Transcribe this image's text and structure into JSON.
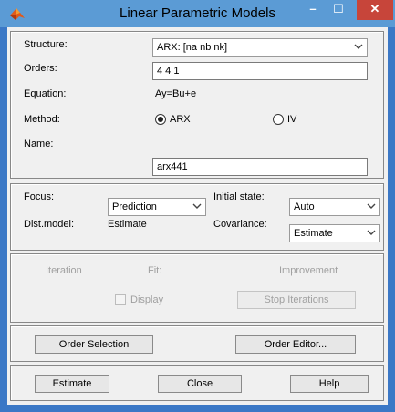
{
  "window": {
    "title": "Linear Parametric Models",
    "controls": {
      "minimize": "–",
      "maximize": "☐",
      "close": "✕"
    }
  },
  "model": {
    "structure_label": "Structure:",
    "structure_value": "ARX: [na nb nk]",
    "orders_label": "Orders:",
    "orders_value": "4 4 1",
    "equation_label": "Equation:",
    "equation_value": "Ay=Bu+e",
    "method_label": "Method:",
    "method_options": [
      "ARX",
      "IV"
    ],
    "method_selected": "ARX",
    "name_label": "Name:",
    "name_value": "arx441"
  },
  "options": {
    "focus_label": "Focus:",
    "focus_value": "Prediction",
    "initial_state_label": "Initial state:",
    "initial_state_value": "Auto",
    "dist_model_label": "Dist.model:",
    "dist_model_value": "Estimate",
    "covariance_label": "Covariance:",
    "covariance_value": "Estimate"
  },
  "progress": {
    "iteration_label": "Iteration",
    "fit_label": "Fit:",
    "improvement_label": "Improvement",
    "display_label": "Display",
    "stop_button": "Stop Iterations"
  },
  "order_buttons": {
    "order_selection": "Order Selection",
    "order_editor": "Order Editor..."
  },
  "actions": {
    "estimate": "Estimate",
    "close": "Close",
    "help": "Help"
  },
  "colors": {
    "title_bar": "#5b9bd5",
    "close_button": "#c7453a",
    "window_frame": "#3b78c6",
    "dialog_bg": "#f0f0f0"
  }
}
